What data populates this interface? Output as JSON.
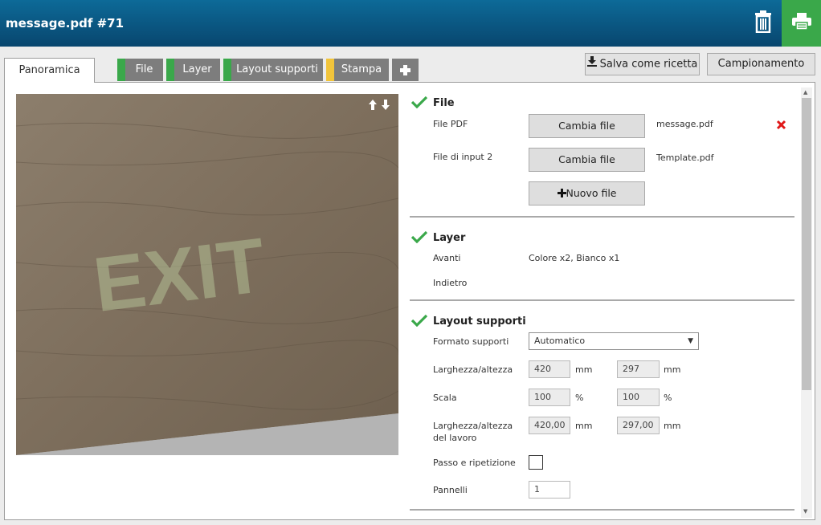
{
  "header": {
    "title": "message.pdf #71"
  },
  "tabs": {
    "overview": "Panoramica",
    "items": [
      {
        "label": "File",
        "color": "#3aa84a"
      },
      {
        "label": "Layer",
        "color": "#3aa84a"
      },
      {
        "label": "Layout supporti",
        "color": "#3aa84a"
      },
      {
        "label": "Stampa",
        "color": "#f2c43a"
      }
    ]
  },
  "toolbar": {
    "save_recipe": "Salva come ricetta",
    "sampling": "Campionamento"
  },
  "preview": {
    "text": "EXIT"
  },
  "file_section": {
    "title": "File",
    "pdf_label": "File PDF",
    "change_label": "Cambia file",
    "pdf_name": "message.pdf",
    "input2_label": "File di input 2",
    "input2_name": "Template.pdf",
    "new_file": "Nuovo file"
  },
  "layer_section": {
    "title": "Layer",
    "front_label": "Avanti",
    "front_value": "Colore x2, Bianco x1",
    "back_label": "Indietro"
  },
  "layout_section": {
    "title": "Layout supporti",
    "format_label": "Formato supporti",
    "format_value": "Automatico",
    "size_label": "Larghezza/altezza",
    "width": "420",
    "height": "297",
    "unit_mm": "mm",
    "scale_label": "Scala",
    "scale_x": "100",
    "scale_y": "100",
    "unit_pct": "%",
    "work_label_1": "Larghezza/altezza",
    "work_label_2": "del lavoro",
    "work_width": "420,00",
    "work_height": "297,00",
    "step_repeat_label": "Passo e ripetizione",
    "panels_label": "Pannelli",
    "panels_value": "1"
  }
}
